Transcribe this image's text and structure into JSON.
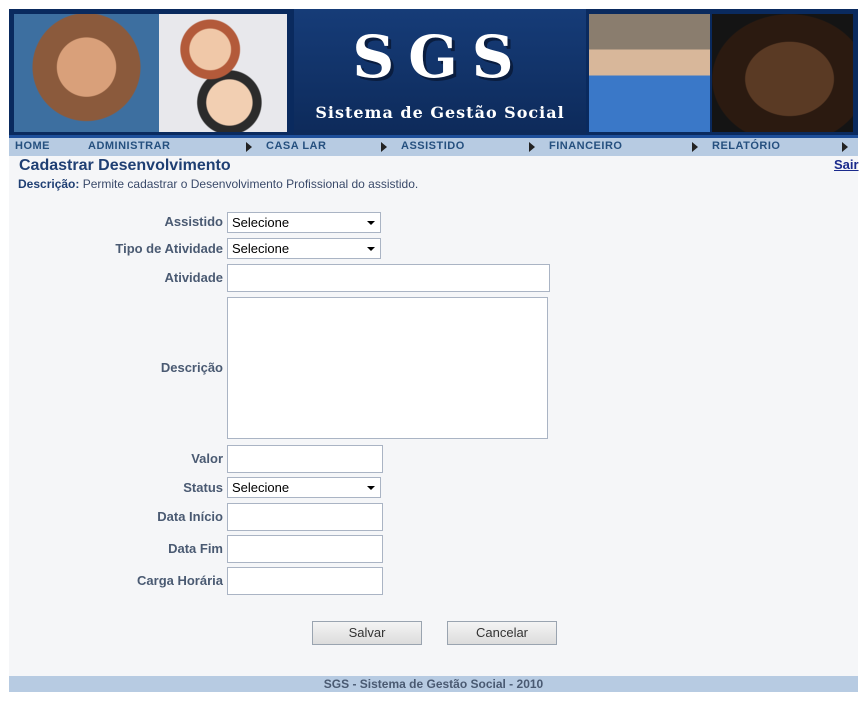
{
  "header": {
    "logo": "SGS",
    "subtitle": "Sistema de Gestão Social"
  },
  "nav": {
    "items": [
      "HOME",
      "ADMINISTRAR",
      "CASA LAR",
      "ASSISTIDO",
      "FINANCEIRO",
      "RELATÓRIO"
    ]
  },
  "page": {
    "title": "Cadastrar Desenvolvimento",
    "logout": "Sair",
    "description_label": "Descrição:",
    "description_text": "Permite cadastrar o Desenvolvimento Profissional do assistido."
  },
  "form": {
    "assistido": {
      "label": "Assistido",
      "value": "Selecione"
    },
    "tipo_atividade": {
      "label": "Tipo de Atividade",
      "value": "Selecione"
    },
    "atividade": {
      "label": "Atividade",
      "value": ""
    },
    "descricao": {
      "label": "Descrição",
      "value": ""
    },
    "valor": {
      "label": "Valor",
      "value": ""
    },
    "status": {
      "label": "Status",
      "value": "Selecione"
    },
    "data_inicio": {
      "label": "Data Início",
      "value": ""
    },
    "data_fim": {
      "label": "Data Fim",
      "value": ""
    },
    "carga_horaria": {
      "label": "Carga Horária",
      "value": ""
    }
  },
  "buttons": {
    "save": "Salvar",
    "cancel": "Cancelar"
  },
  "footer": {
    "text": "SGS - Sistema de Gestão Social - 2010"
  },
  "colors": {
    "nav_bg": "#b7cbe2",
    "title": "#1f3f73",
    "banner": "#0a2a5e"
  }
}
